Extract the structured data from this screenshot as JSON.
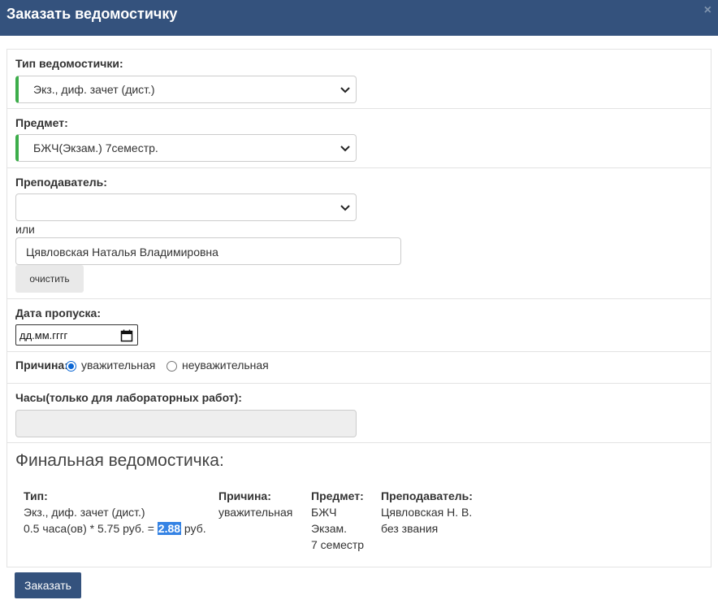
{
  "dialog": {
    "title": "Заказать ведомостичку",
    "close_icon": "×"
  },
  "form": {
    "type_label": "Тип ведомостички:",
    "type_value": "Экз., диф. зачет (дист.)",
    "subject_label": "Предмет:",
    "subject_value": "БЖЧ(Экзам.) 7семестр.",
    "teacher_label": "Преподаватель:",
    "teacher_select_value": "",
    "or_text": "или",
    "teacher_input_value": "Цявловская Наталья Владимировна",
    "clear_button": "очистить",
    "date_label": "Дата пропуска:",
    "date_placeholder": "дд.мм.гггг",
    "reason_label": "Причина:",
    "reason_options": [
      "уважительная",
      "неуважительная"
    ],
    "reason_selected": "уважительная",
    "hours_label": "Часы(только для лабораторных работ):",
    "hours_value": ""
  },
  "final": {
    "title": "Финальная ведомостичка:",
    "type_header": "Тип:",
    "type_value": "Экз., диф. зачет (дист.)",
    "cost_prefix": "0.5 часа(ов) * 5.75 руб. = ",
    "cost_value": "2.88",
    "cost_suffix": " руб.",
    "reason_header": "Причина:",
    "reason_value": "уважительная",
    "subject_header": "Предмет:",
    "subject_lines": [
      "БЖЧ",
      "Экзам.",
      "7 семестр"
    ],
    "teacher_header": "Преподаватель:",
    "teacher_lines": [
      "Цявловская Н. В.",
      "без звания"
    ]
  },
  "order_button": "Заказать",
  "colors": {
    "header": "#34527d",
    "valid_accent": "#3cad4a",
    "selection": "#3583e4",
    "radio_checked": "#0a66d4"
  },
  "icons": {
    "close": "close-icon",
    "select": "chevron-down-icon",
    "date": "calendar-icon"
  }
}
